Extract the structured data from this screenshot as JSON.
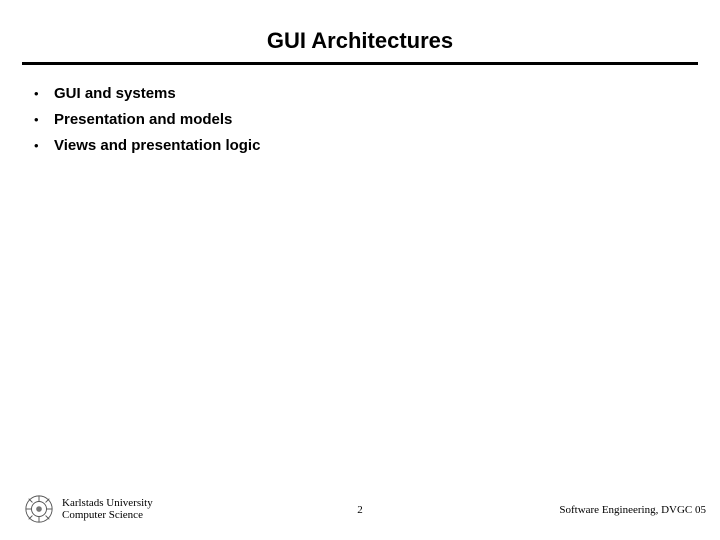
{
  "title": "GUI Architectures",
  "bullets": [
    {
      "text": "GUI and systems"
    },
    {
      "text": "Presentation and models"
    },
    {
      "text": "Views and presentation logic"
    }
  ],
  "footer": {
    "institution_line1": "Karlstads University",
    "institution_line2": "Computer Science",
    "page_number": "2",
    "course": "Software Engineering, DVGC 05"
  }
}
